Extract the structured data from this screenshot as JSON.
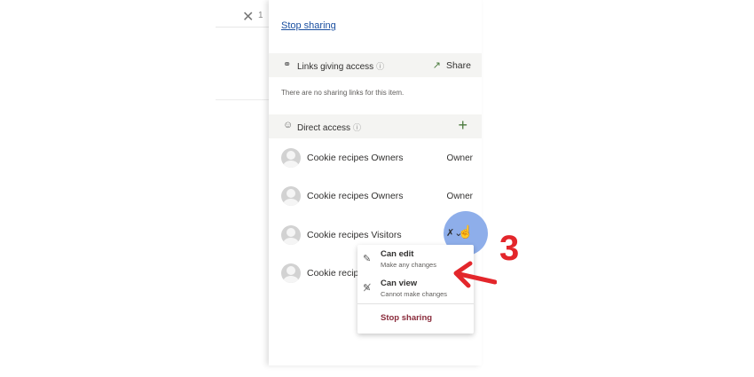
{
  "background": {
    "close_glyph": "✕",
    "close_number": "1"
  },
  "panel": {
    "stop_sharing_link": "Stop sharing",
    "links_section": {
      "icon": "link-icon",
      "title": "Links giving access",
      "info_glyph": "ⓘ",
      "share_label": "Share",
      "share_icon": "share-icon",
      "empty_message": "There are no sharing links for this item."
    },
    "direct_section": {
      "icon": "people-icon",
      "title": "Direct access",
      "info_glyph": "ⓘ",
      "add_glyph": "+"
    },
    "people": [
      {
        "name": "Cookie recipes Owners",
        "role": "Owner"
      },
      {
        "name": "Cookie recipes Owners",
        "role": "Owner"
      },
      {
        "name": "Cookie recipes Visitors",
        "role": ""
      },
      {
        "name": "Cookie recip",
        "role": ""
      }
    ]
  },
  "permission_menu": {
    "options": [
      {
        "title": "Can edit",
        "subtitle": "Make any changes",
        "icon": "pencil-icon"
      },
      {
        "title": "Can view",
        "subtitle": "Cannot make changes",
        "icon": "no-edit-icon"
      }
    ],
    "stop_label": "Stop sharing"
  },
  "annotation": {
    "step_number": "3",
    "color": "#e3262b"
  },
  "colors": {
    "link": "#1a4fa0",
    "accent_green": "#4a7a3d",
    "stop_red": "#8a2b3b",
    "highlight_blue": "#7aa0e6"
  }
}
